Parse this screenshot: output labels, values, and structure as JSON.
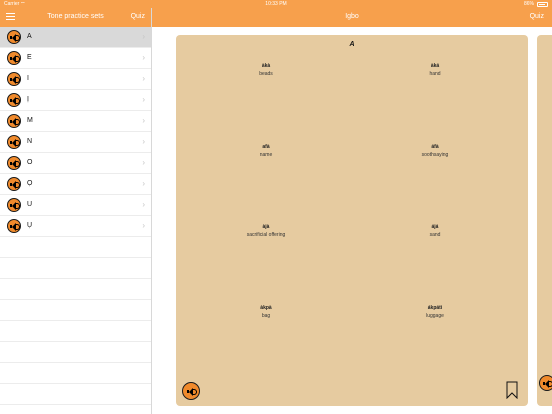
{
  "status": {
    "carrier": "Carrier",
    "time": "10:33 PM",
    "battery": "86%"
  },
  "nav": {
    "left_title": "Tone practice sets",
    "left_quiz": "Quiz",
    "right_title": "Igbo",
    "right_quiz": "Quiz"
  },
  "sidebar": {
    "items": [
      {
        "label": "A",
        "selected": true
      },
      {
        "label": "E"
      },
      {
        "label": "I"
      },
      {
        "label": "Ị"
      },
      {
        "label": "M"
      },
      {
        "label": "N"
      },
      {
        "label": "O"
      },
      {
        "label": "Ọ"
      },
      {
        "label": "U"
      },
      {
        "label": "Ụ"
      }
    ]
  },
  "card": {
    "title": "A",
    "words": [
      {
        "igbo": "àkà",
        "english": "beads"
      },
      {
        "igbo": "àká",
        "english": "hand"
      },
      {
        "igbo": "afà",
        "english": "name"
      },
      {
        "igbo": "áfà",
        "english": "soothsaying"
      },
      {
        "igbo": "àjà",
        "english": "sacrificial offering"
      },
      {
        "igbo": "ájá",
        "english": "sand"
      },
      {
        "igbo": "àkpà",
        "english": "bag"
      },
      {
        "igbo": "ákpátì",
        "english": "luggage"
      }
    ]
  },
  "icons": {
    "speaker": "speaker-icon",
    "bookmark": "bookmark-icon",
    "menu": "menu-icon",
    "chevron": "chevron-right-icon"
  },
  "colors": {
    "accent": "#f7a04c",
    "card": "#e6cba0",
    "speaker": "#f08a2c"
  }
}
